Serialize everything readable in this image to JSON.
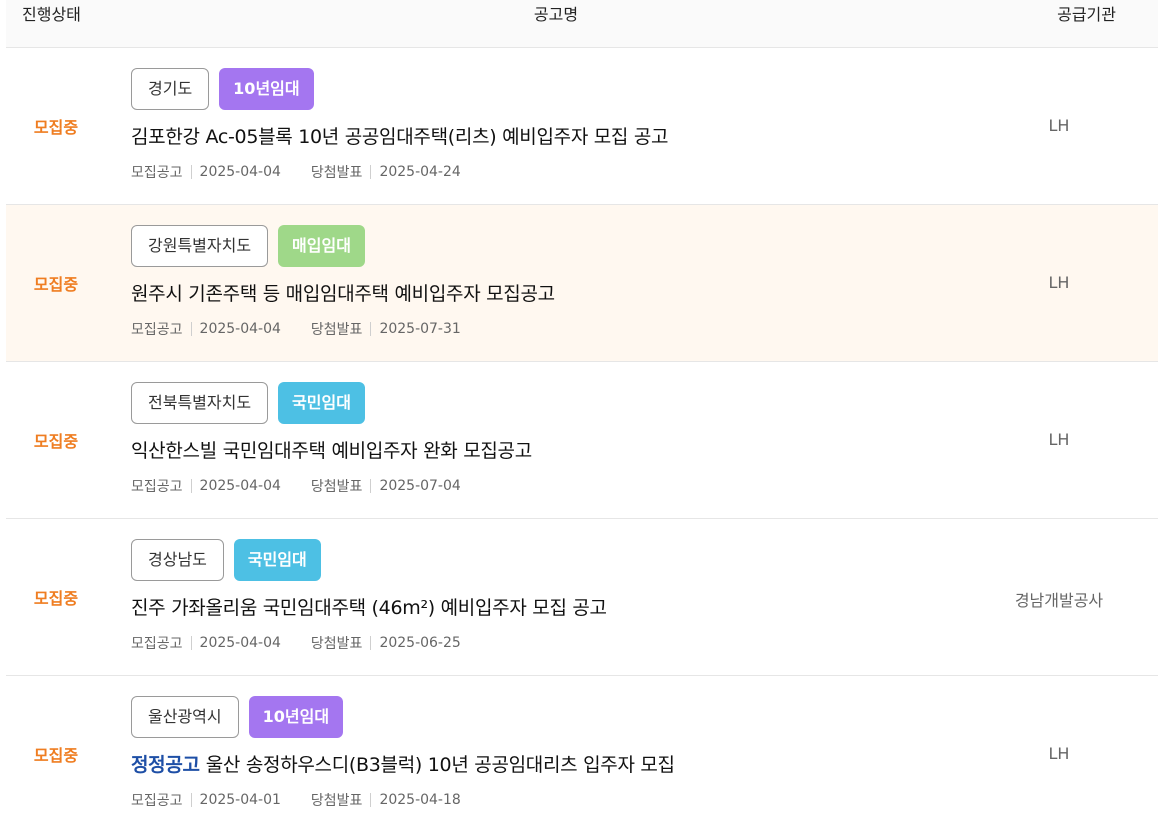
{
  "header": {
    "status": "진행상태",
    "title": "공고명",
    "org": "공급기관"
  },
  "rows": [
    {
      "status": "모집중",
      "region": "경기도",
      "type": "10년임대",
      "type_color": "#a476f0",
      "correction": "",
      "title": "김포한강 Ac-05블록 10년 공공임대주택(리츠) 예비입주자 모집 공고",
      "notice_label": "모집공고",
      "notice_date": "2025-04-04",
      "winner_label": "당첨발표",
      "winner_date": "2025-04-24",
      "org": "LH"
    },
    {
      "status": "모집중",
      "region": "강원특별자치도",
      "type": "매입임대",
      "type_color": "#9fd889",
      "correction": "",
      "title": "원주시 기존주택 등 매입임대주택 예비입주자 모집공고",
      "notice_label": "모집공고",
      "notice_date": "2025-04-04",
      "winner_label": "당첨발표",
      "winner_date": "2025-07-31",
      "org": "LH"
    },
    {
      "status": "모집중",
      "region": "전북특별자치도",
      "type": "국민임대",
      "type_color": "#4dc0e4",
      "correction": "",
      "title": "익산한스빌 국민임대주택 예비입주자 완화 모집공고",
      "notice_label": "모집공고",
      "notice_date": "2025-04-04",
      "winner_label": "당첨발표",
      "winner_date": "2025-07-04",
      "org": "LH"
    },
    {
      "status": "모집중",
      "region": "경상남도",
      "type": "국민임대",
      "type_color": "#4dc0e4",
      "correction": "",
      "title": "진주 가좌올리움 국민임대주택 (46m²) 예비입주자 모집 공고",
      "notice_label": "모집공고",
      "notice_date": "2025-04-04",
      "winner_label": "당첨발표",
      "winner_date": "2025-06-25",
      "org": "경남개발공사"
    },
    {
      "status": "모집중",
      "region": "울산광역시",
      "type": "10년임대",
      "type_color": "#a476f0",
      "correction": "정정공고",
      "title": "울산 송정하우스디(B3블럭) 10년 공공임대리츠 입주자 모집",
      "notice_label": "모집공고",
      "notice_date": "2025-04-01",
      "winner_label": "당첨발표",
      "winner_date": "2025-04-18",
      "org": "LH"
    }
  ]
}
